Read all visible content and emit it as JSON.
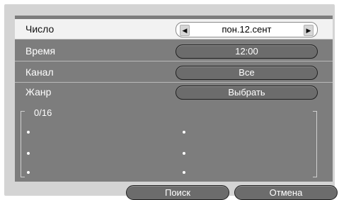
{
  "form": {
    "rows": [
      {
        "label": "Число"
      },
      {
        "label": "Время",
        "value": "12:00"
      },
      {
        "label": "Канал",
        "value": "Все"
      },
      {
        "label": "Жанр",
        "value": "Выбрать"
      }
    ],
    "date_value": "пон.12.сент"
  },
  "results": {
    "count": "0/16"
  },
  "buttons": {
    "search": "Поиск",
    "cancel": "Отмена"
  },
  "icons": {
    "prev": "arrow-left-icon",
    "next": "arrow-right-icon"
  },
  "colors": {
    "panel": "#7d7d7d",
    "frame": "#d4d4d4",
    "selected_row": "#f2f2f2",
    "button": "#6c6c6c"
  }
}
